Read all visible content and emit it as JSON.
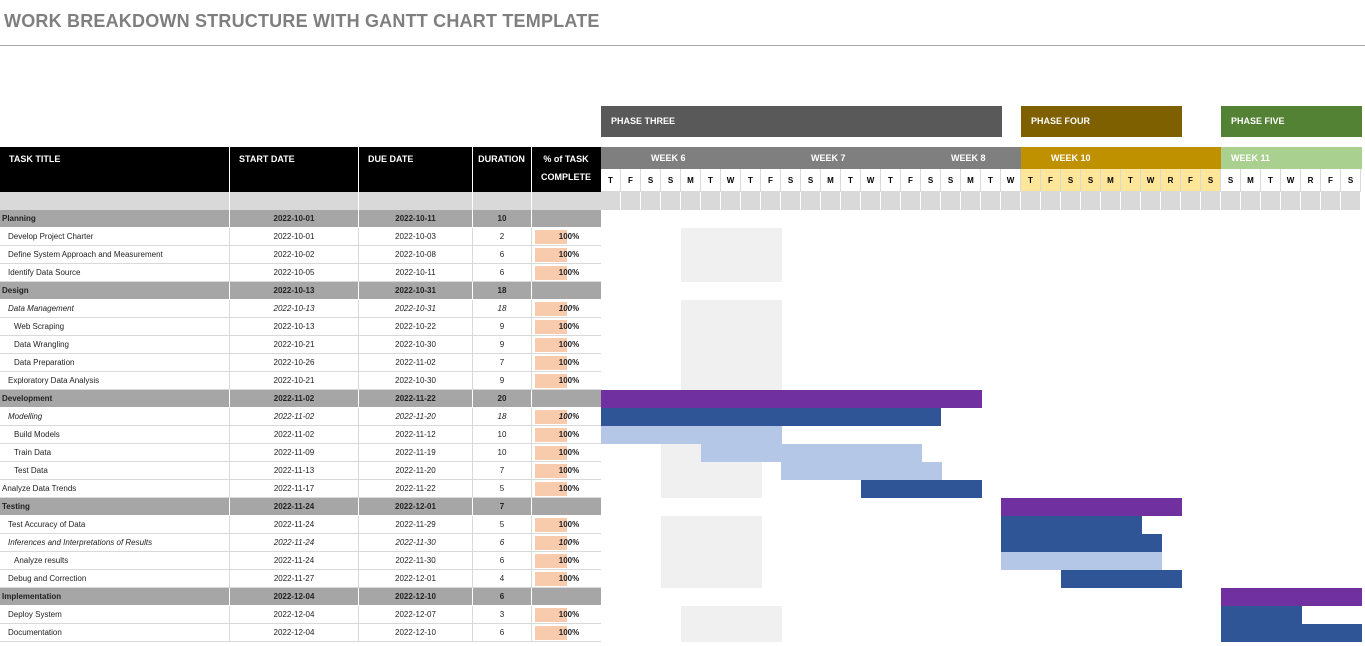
{
  "title": "WORK BREAKDOWN STRUCTURE WITH GANTT CHART TEMPLATE",
  "phases": [
    {
      "label": "PHASE THREE",
      "color": "#595959"
    },
    {
      "label": "PHASE FOUR",
      "color": "#7f6000"
    },
    {
      "label": "PHASE FIVE",
      "color": "#548235"
    }
  ],
  "columns": {
    "task": "TASK TITLE",
    "start": "START DATE",
    "due": "DUE DATE",
    "duration": "DURATION",
    "pct_line1": "% of TASK",
    "pct_line2": "COMPLETE"
  },
  "weeks": [
    {
      "label": "WEEK 6",
      "color": "#7f7f7f",
      "text": "#ffffff"
    },
    {
      "label": "WEEK 7",
      "color": "#7f7f7f",
      "text": "#ffffff"
    },
    {
      "label": "WEEK 8",
      "color": "#7f7f7f",
      "text": "#ffffff"
    },
    {
      "label": "WEEK 10",
      "color": "#bf9000",
      "text": "#ffffff"
    },
    {
      "label": "WEEK 11",
      "color": "#a9d08e",
      "text": "#ffffff"
    }
  ],
  "days": [
    "T",
    "F",
    "S",
    "S",
    "M",
    "T",
    "W",
    "T",
    "F",
    "S",
    "S",
    "M",
    "T",
    "W",
    "T",
    "F",
    "S",
    "S",
    "M",
    "T",
    "W",
    "T",
    "F",
    "S",
    "S",
    "M",
    "T",
    "W",
    "R",
    "F",
    "S",
    "S",
    "M",
    "T",
    "W",
    "R",
    "F",
    "S"
  ],
  "day_colors": {
    "default": "#ffffff",
    "week10": "#ffe699"
  },
  "bar_colors": {
    "summary": "#7030a0",
    "dark": "#2f5597",
    "light": "#b4c7e7"
  },
  "rows": [
    {
      "task": "Planning",
      "start": "2022-10-01",
      "due": "2022-10-11",
      "duration": "10",
      "pct": "",
      "type": "group"
    },
    {
      "task": "Develop Project Charter",
      "start": "2022-10-01",
      "due": "2022-10-03",
      "duration": "2",
      "pct": "100%",
      "type": "task"
    },
    {
      "task": "Define System Approach and Measurement",
      "start": "2022-10-02",
      "due": "2022-10-08",
      "duration": "6",
      "pct": "100%",
      "type": "task"
    },
    {
      "task": "Identify Data Source",
      "start": "2022-10-05",
      "due": "2022-10-11",
      "duration": "6",
      "pct": "100%",
      "type": "task"
    },
    {
      "task": "Design",
      "start": "2022-10-13",
      "due": "2022-10-31",
      "duration": "18",
      "pct": "",
      "type": "group"
    },
    {
      "task": "Data Management",
      "start": "2022-10-13",
      "due": "2022-10-31",
      "duration": "18",
      "pct": "100%",
      "type": "sub"
    },
    {
      "task": "Web Scraping",
      "start": "2022-10-13",
      "due": "2022-10-22",
      "duration": "9",
      "pct": "100%",
      "type": "task2"
    },
    {
      "task": "Data Wrangling",
      "start": "2022-10-21",
      "due": "2022-10-30",
      "duration": "9",
      "pct": "100%",
      "type": "task2"
    },
    {
      "task": "Data Preparation",
      "start": "2022-10-26",
      "due": "2022-11-02",
      "duration": "7",
      "pct": "100%",
      "type": "task2"
    },
    {
      "task": "Exploratory Data Analysis",
      "start": "2022-10-21",
      "due": "2022-10-30",
      "duration": "9",
      "pct": "100%",
      "type": "task"
    },
    {
      "task": "Development",
      "start": "2022-11-02",
      "due": "2022-11-22",
      "duration": "20",
      "pct": "",
      "type": "group"
    },
    {
      "task": "Modelling",
      "start": "2022-11-02",
      "due": "2022-11-20",
      "duration": "18",
      "pct": "100%",
      "type": "sub"
    },
    {
      "task": "Build Models",
      "start": "2022-11-02",
      "due": "2022-11-12",
      "duration": "10",
      "pct": "100%",
      "type": "task2"
    },
    {
      "task": "Train Data",
      "start": "2022-11-09",
      "due": "2022-11-19",
      "duration": "10",
      "pct": "100%",
      "type": "task2"
    },
    {
      "task": "Test Data",
      "start": "2022-11-13",
      "due": "2022-11-20",
      "duration": "7",
      "pct": "100%",
      "type": "task2"
    },
    {
      "task": "Analyze Data Trends",
      "start": "2022-11-17",
      "due": "2022-11-22",
      "duration": "5",
      "pct": "100%",
      "type": "task0"
    },
    {
      "task": "Testing",
      "start": "2022-11-24",
      "due": "2022-12-01",
      "duration": "7",
      "pct": "",
      "type": "group"
    },
    {
      "task": "Test Accuracy of Data",
      "start": "2022-11-24",
      "due": "2022-11-29",
      "duration": "5",
      "pct": "100%",
      "type": "task"
    },
    {
      "task": "Inferences and Interpretations of Results",
      "start": "2022-11-24",
      "due": "2022-11-30",
      "duration": "6",
      "pct": "100%",
      "type": "sub"
    },
    {
      "task": "Analyze results",
      "start": "2022-11-24",
      "due": "2022-11-30",
      "duration": "6",
      "pct": "100%",
      "type": "task2"
    },
    {
      "task": "Debug and Correction",
      "start": "2022-11-27",
      "due": "2022-12-01",
      "duration": "4",
      "pct": "100%",
      "type": "task"
    },
    {
      "task": "Implementation",
      "start": "2022-12-04",
      "due": "2022-12-10",
      "duration": "6",
      "pct": "",
      "type": "group"
    },
    {
      "task": "Deploy System",
      "start": "2022-12-04",
      "due": "2022-12-07",
      "duration": "3",
      "pct": "100%",
      "type": "task"
    },
    {
      "task": "Documentation",
      "start": "2022-12-04",
      "due": "2022-12-10",
      "duration": "6",
      "pct": "100%",
      "type": "task"
    }
  ]
}
